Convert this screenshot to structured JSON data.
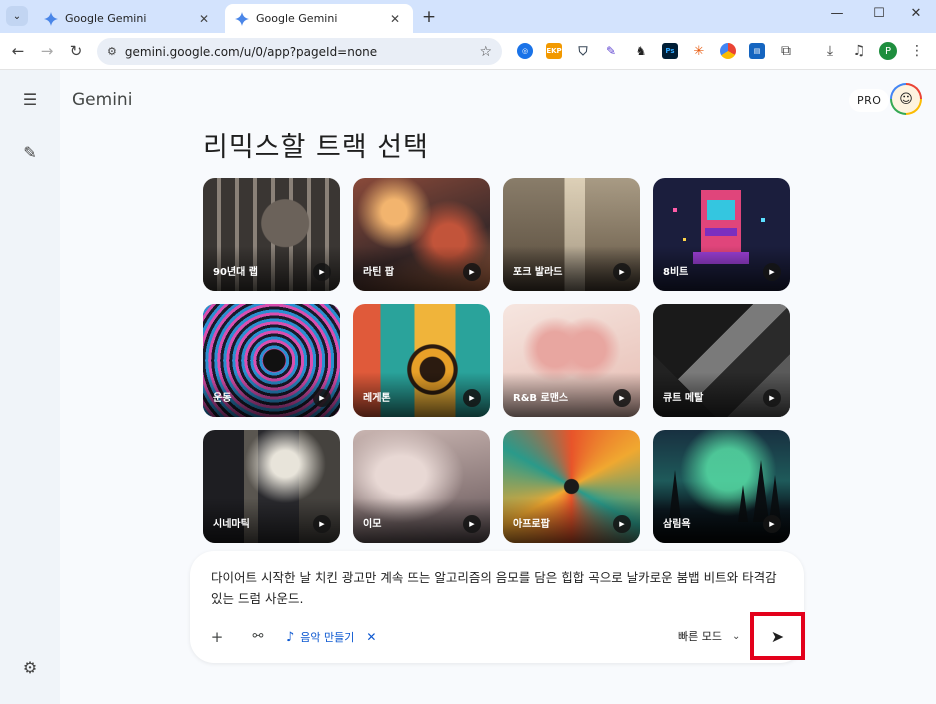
{
  "browser": {
    "tabs": [
      {
        "label": "Google Gemini",
        "active": false
      },
      {
        "label": "Google Gemini",
        "active": true
      }
    ],
    "url": "gemini.google.com/u/0/app?pageId=none",
    "profile_initial": "P",
    "extensions": [
      "ext-blue",
      "ext-orange",
      "ext-dark",
      "ext-purple",
      "ext-game",
      "ext-ps",
      "ext-sun",
      "ext-color",
      "ext-blue2",
      "ext-puzzle"
    ]
  },
  "app": {
    "brand": "Gemini",
    "pro_badge": "PRO",
    "page_title": "리믹스할 트랙 선택",
    "tracks": [
      {
        "label": "90년대 랩"
      },
      {
        "label": "라틴 팝"
      },
      {
        "label": "포크 발라드"
      },
      {
        "label": "8비트"
      },
      {
        "label": "운동"
      },
      {
        "label": "레게톤"
      },
      {
        "label": "R&B 로맨스"
      },
      {
        "label": "큐트 메탈"
      },
      {
        "label": "시네마틱"
      },
      {
        "label": "이모"
      },
      {
        "label": "아프로팝"
      },
      {
        "label": "삼림욕"
      }
    ],
    "composer": {
      "prompt": "다이어트 시작한 날 치킨 광고만 계속 뜨는 알고리즘의 음모를 담은 힙합 곡으로 날카로운 붐뱁 비트와 타격감 있는 드럼 사운드.",
      "chip_label": "음악 만들기",
      "mode_label": "빠른 모드"
    }
  },
  "colors": {
    "highlight": "#e3001b",
    "accent": "#0b57d0"
  }
}
